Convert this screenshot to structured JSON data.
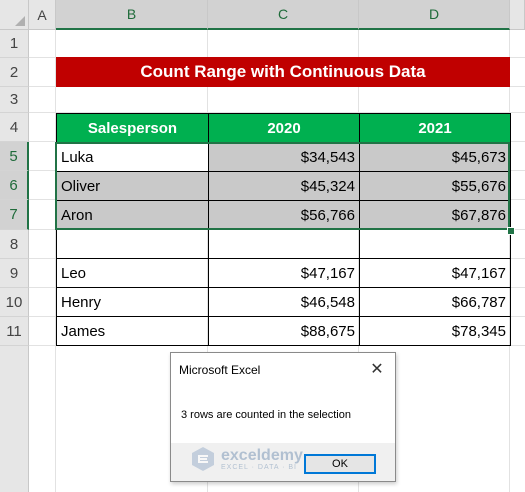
{
  "columns": [
    "A",
    "B",
    "C",
    "D"
  ],
  "rows": [
    "1",
    "2",
    "3",
    "4",
    "5",
    "6",
    "7",
    "8",
    "9",
    "10",
    "11"
  ],
  "title": "Count Range with Continuous Data",
  "table": {
    "headers": [
      "Salesperson",
      "2020",
      "2021"
    ],
    "rows": [
      [
        "Luka",
        "$34,543",
        "$45,673"
      ],
      [
        "Oliver",
        "$45,324",
        "$55,676"
      ],
      [
        "Aron",
        "$56,766",
        "$67,876"
      ],
      [
        "",
        "",
        ""
      ],
      [
        "Leo",
        "$47,167",
        "$47,167"
      ],
      [
        "Henry",
        "$46,548",
        "$66,787"
      ],
      [
        "James",
        "$88,675",
        "$78,345"
      ]
    ]
  },
  "dialog": {
    "title": "Microsoft Excel",
    "message": "3 rows are counted in the selection",
    "ok_label": "OK",
    "close_glyph": "✕"
  },
  "watermark": {
    "brand": "exceldemy",
    "tagline": "EXCEL · DATA · BI"
  },
  "colors": {
    "title_bg": "#c00000",
    "header_bg": "#00b050",
    "selection": "#217346"
  }
}
